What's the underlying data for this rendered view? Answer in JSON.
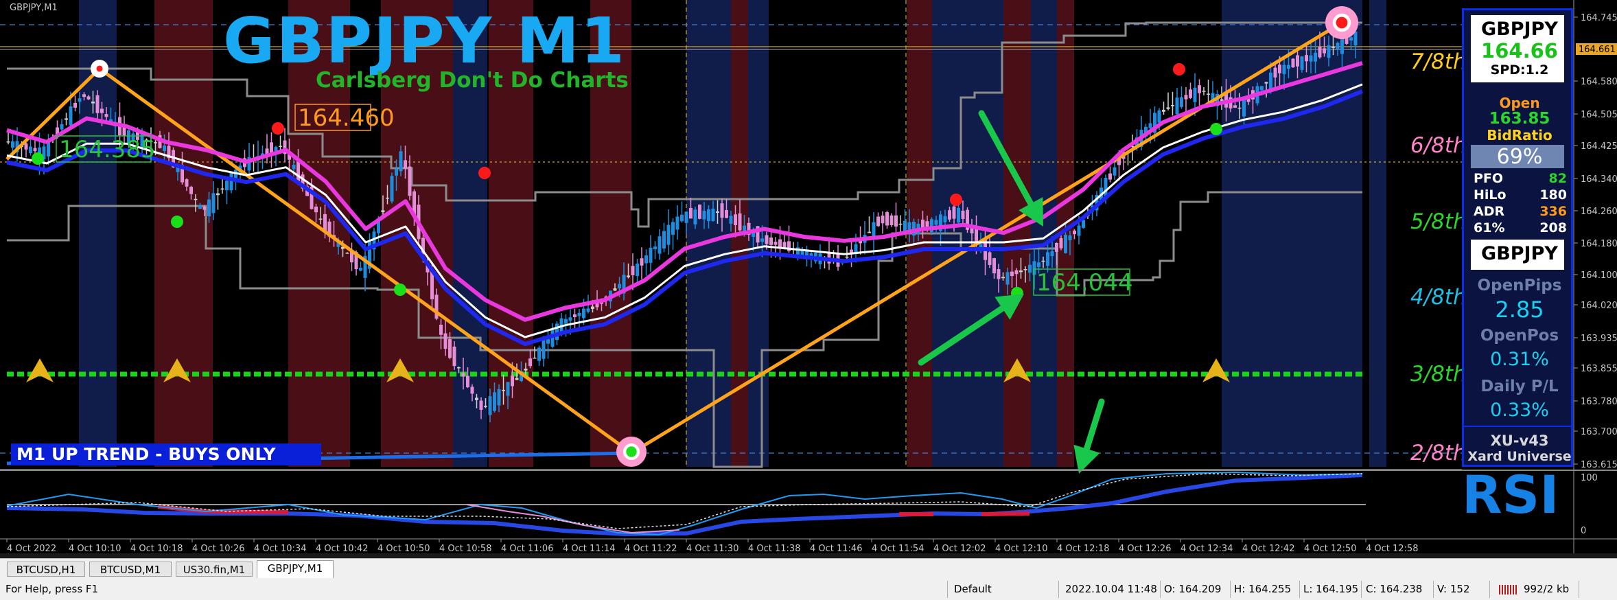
{
  "chart_tag": "GBPJPY,M1",
  "title": "GBPJPY M1",
  "subtitle": "Carlsberg Don't Do Charts",
  "trend_banner": "M1 UP TREND - BUYS ONLY",
  "rsi_title": "RSI",
  "colors": {
    "background": "#000000",
    "session_blue": "#101d4a",
    "session_red": "#4a0f16",
    "bull_candle": "#1e8de0",
    "bear_candle": "#e58ed8",
    "neutral_candle": "#cfcfcf",
    "ma_magenta": "#ea38e0",
    "ma_blue": "#1e28f0",
    "zigzag": "#ffa41a",
    "channel": "#8c8c8c",
    "green_level": "#19d419",
    "title_blue": "#19a9f2"
  },
  "chart_data": {
    "type": "candlestick",
    "x_range": [
      "4 Oct 2022 10:02",
      "4 Oct 12:58"
    ],
    "ylim": [
      163.615,
      164.745
    ],
    "grid": false,
    "x_ticks": [
      "4 Oct 2022",
      "4 Oct 10:10",
      "4 Oct 10:18",
      "4 Oct 10:26",
      "4 Oct 10:34",
      "4 Oct 10:42",
      "4 Oct 10:50",
      "4 Oct 10:58",
      "4 Oct 11:06",
      "4 Oct 11:14",
      "4 Oct 11:22",
      "4 Oct 11:30",
      "4 Oct 11:38",
      "4 Oct 11:46",
      "4 Oct 11:54",
      "4 Oct 12:02",
      "4 Oct 12:10",
      "4 Oct 12:18",
      "4 Oct 12:26",
      "4 Oct 12:34",
      "4 Oct 12:42",
      "4 Oct 12:50",
      "4 Oct 12:58"
    ],
    "y_ticks": [
      "164.745",
      "164.580",
      "164.505",
      "164.425",
      "164.340",
      "164.260",
      "164.180",
      "164.100",
      "164.020",
      "163.935",
      "163.855",
      "163.780",
      "163.700",
      "163.615"
    ],
    "current_price_labels": [
      "164.661"
    ],
    "price_path": [
      164.43,
      164.4,
      164.55,
      164.45,
      164.42,
      164.25,
      164.37,
      164.42,
      164.22,
      164.1,
      164.4,
      163.93,
      163.75,
      163.84,
      163.97,
      164.02,
      164.12,
      164.24,
      164.25,
      164.18,
      164.15,
      164.12,
      164.23,
      164.21,
      164.25,
      164.08,
      164.12,
      164.21,
      164.38,
      164.5,
      164.56,
      164.51,
      164.61,
      164.65,
      164.7
    ],
    "ma_fast": [
      164.45,
      164.42,
      164.48,
      164.46,
      164.42,
      164.4,
      164.37,
      164.4,
      164.32,
      164.2,
      164.27,
      164.1,
      164.02,
      163.97,
      164.0,
      164.02,
      164.07,
      164.15,
      164.18,
      164.2,
      164.18,
      164.17,
      164.18,
      164.2,
      164.21,
      164.19,
      164.23,
      164.3,
      164.4,
      164.47,
      164.51,
      164.53,
      164.56,
      164.59,
      164.62
    ],
    "ma_slow": [
      164.4,
      164.38,
      164.43,
      164.43,
      164.4,
      164.37,
      164.35,
      164.37,
      164.3,
      164.18,
      164.22,
      164.08,
      163.99,
      163.94,
      163.97,
      163.99,
      164.04,
      164.12,
      164.15,
      164.17,
      164.16,
      164.15,
      164.16,
      164.18,
      164.18,
      164.18,
      164.19,
      164.26,
      164.35,
      164.42,
      164.46,
      164.49,
      164.51,
      164.54,
      164.58
    ],
    "zigzag": [
      {
        "x": "4 Oct 2022 10:02",
        "y": 164.37
      },
      {
        "x": "4 Oct 10:08",
        "y": 164.6
      },
      {
        "x": "4 Oct 11:22",
        "y": 163.61
      },
      {
        "x": "4 Oct 12:52",
        "y": 164.74
      }
    ],
    "price_labels": [
      {
        "text": "164.460",
        "color": "#ff9a1a"
      },
      {
        "text": "164.385",
        "color": "#28c23a"
      },
      {
        "text": "164.044",
        "color": "#28c23a"
      }
    ],
    "murrey_levels": [
      {
        "label": "7/8th",
        "value": 164.58,
        "color": "#ffce1a"
      },
      {
        "label": "6/8th",
        "value": 164.38,
        "color": "#ff82c8"
      },
      {
        "label": "5/8th",
        "value": 164.19,
        "color": "#2cd42c"
      },
      {
        "label": "4/8th",
        "value": 163.99,
        "color": "#1ec0e6"
      },
      {
        "label": "3/8th",
        "value": 163.8,
        "color": "#2cd42c"
      },
      {
        "label": "2/8th",
        "value": 163.6,
        "color": "#ff82c8"
      }
    ],
    "rsi_range": [
      0,
      100
    ],
    "rsi_ticks": [
      "100",
      "0"
    ]
  },
  "info_panel": {
    "symbol": "GBPJPY",
    "price": "164.66",
    "spread": "SPD:1.2",
    "open_label": "Open",
    "open_value": "163.85",
    "bidratio_label": "BidRatio",
    "bidratio_value": "69%",
    "stats": [
      {
        "key": "PFO",
        "value": "82",
        "color": "#2ad62a"
      },
      {
        "key": "HiLo",
        "value": "180",
        "color": "#ffffff"
      },
      {
        "key": "ADR",
        "value": "336",
        "color": "#ff9a1a"
      },
      {
        "key": "61%",
        "value": "208",
        "color": "#ffffff"
      }
    ],
    "symbol2": "GBPJPY",
    "openpips_label": "OpenPips",
    "openpips_value": "2.85",
    "openpos_label": "OpenPos",
    "openpos_value": "0.31%",
    "dailypl_label": "Daily P/L",
    "dailypl_value": "0.33%",
    "version": "XU-v43",
    "brand": "Xard Universe"
  },
  "tabs": [
    "BTCUSD,H1",
    "BTCUSD,M1",
    "US30.fin,M1",
    "GBPJPY,M1"
  ],
  "active_tab": 3,
  "status": {
    "help": "For Help, press F1",
    "profile": "Default",
    "datetime": "2022.10.04 11:48",
    "open": "O: 164.209",
    "high": "H: 164.255",
    "low": "L: 164.195",
    "close": "C: 164.238",
    "volume": "V: 152",
    "traffic": "992/2 kb"
  }
}
